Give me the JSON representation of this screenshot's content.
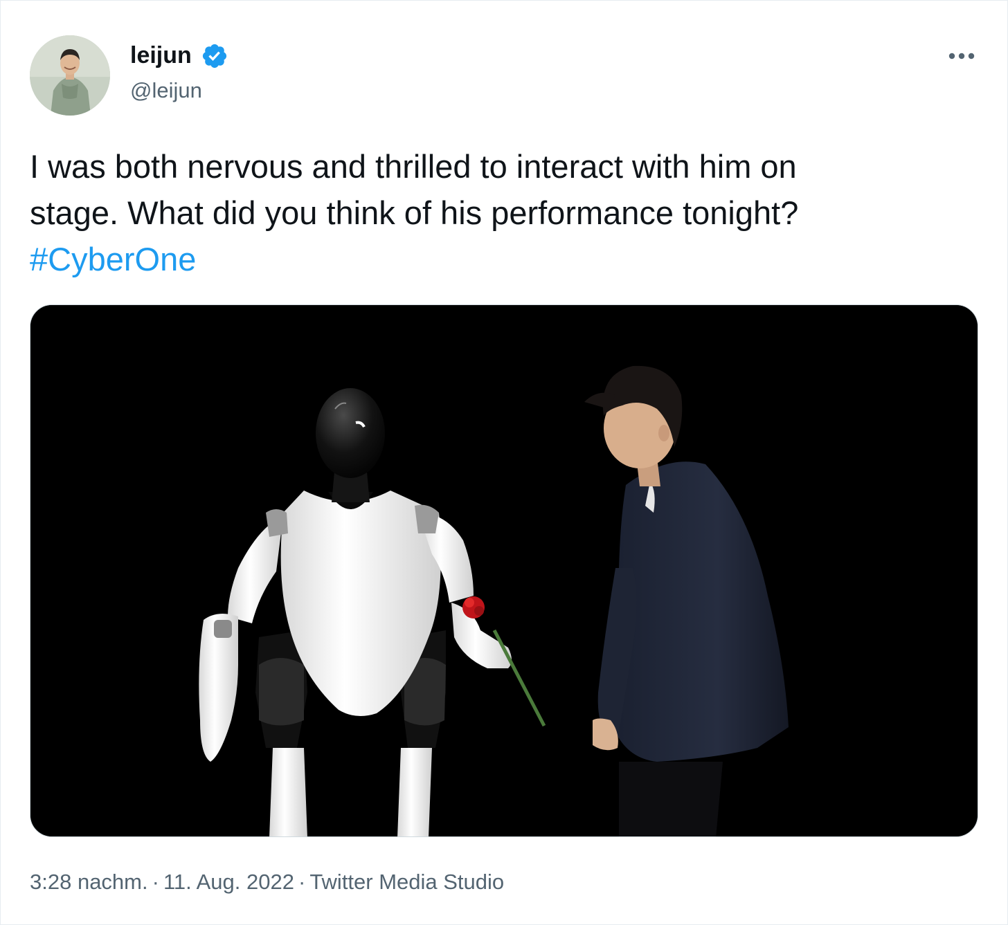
{
  "author": {
    "name": "leijun",
    "handle": "@leijun",
    "verified": true
  },
  "tweet": {
    "text_line_1": "I was both nervous and thrilled to interact with him on",
    "text_line_2": "stage. What did you think of his performance tonight?",
    "hashtag": "#CyberOne"
  },
  "media": {
    "type": "video-frame",
    "background": "#000000"
  },
  "meta": {
    "time": "3:28 nachm.",
    "separator": "·",
    "date": "11. Aug. 2022",
    "source": "Twitter Media Studio"
  },
  "icons": {
    "verified": "verified-badge-icon",
    "more": "more-dots-icon"
  },
  "colors": {
    "accent": "#1d9bf0",
    "text": "#0f1419",
    "secondary": "#536471"
  }
}
